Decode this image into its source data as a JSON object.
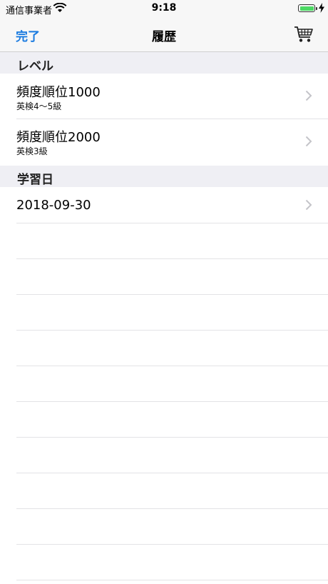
{
  "status_bar": {
    "carrier": "通信事業者",
    "time": "9:18"
  },
  "nav": {
    "done_label": "完了",
    "title": "履歴"
  },
  "sections": [
    {
      "header": "レベル",
      "rows": [
        {
          "title": "頻度順位1000",
          "subtitle": "英検4〜5級"
        },
        {
          "title": "頻度順位2000",
          "subtitle": "英検3級"
        }
      ]
    },
    {
      "header": "学習日",
      "rows": [
        {
          "title": "2018-09-30"
        }
      ]
    }
  ],
  "colors": {
    "accent": "#1a7be0",
    "section_bg": "#efeff4",
    "battery": "#4cd964"
  },
  "icons": [
    "wifi-icon",
    "battery-icon",
    "charging-bolt-icon",
    "cart-icon",
    "chevron-right-icon"
  ]
}
